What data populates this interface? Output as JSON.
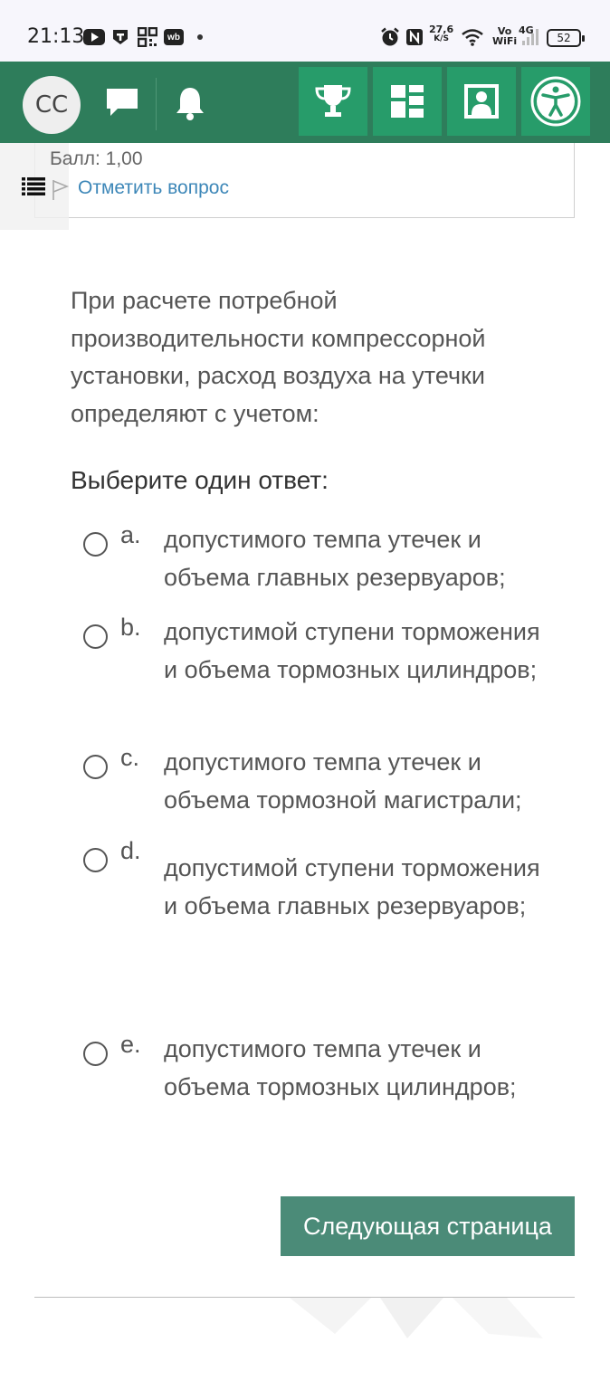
{
  "status_bar": {
    "time": "21:13",
    "net_speed_value": "27,6",
    "net_speed_unit": "K/S",
    "volte_top": "Vo",
    "volte_bottom": "WiFi",
    "network": "4G",
    "battery": "52",
    "icons": [
      "youtube-icon",
      "tasks-icon",
      "qr-icon",
      "wb-icon",
      "dot-icon",
      "alarm-icon",
      "nfc-icon",
      "wifi-icon",
      "signal-icon",
      "battery-icon"
    ],
    "wb_label": "wb"
  },
  "header": {
    "avatar_initials": "CC",
    "icons": [
      "message-icon",
      "bell-icon"
    ],
    "buttons": [
      {
        "name": "trophy-button",
        "icon": "trophy-icon"
      },
      {
        "name": "dashboard-button",
        "icon": "dashboard-icon"
      },
      {
        "name": "profile-button",
        "icon": "profile-icon"
      },
      {
        "name": "accessibility-button",
        "icon": "accessibility-icon"
      }
    ],
    "colors": {
      "bar": "#2e7d5b",
      "button": "#279c6a"
    }
  },
  "question_info": {
    "score": "Балл: 1,00",
    "flag_label": "Отметить вопрос"
  },
  "question": {
    "text": "При расчете потребной производительности компрессорной установки, расход воздуха на утечки определяют с учетом:",
    "prompt": "Выберите один ответ:",
    "options": [
      {
        "letter": "a.",
        "text": "допустимого темпа утечек и объема главных резервуаров;",
        "selected": false
      },
      {
        "letter": "b.",
        "text": "допустимой ступени торможения и объема тормозных цилиндров;",
        "selected": false
      },
      {
        "letter": "c.",
        "text": "допустимого темпа утечек и объема тормозной магистрали;",
        "selected": false
      },
      {
        "letter": "d.",
        "text": "допустимой ступени торможения и объема главных резервуаров;",
        "selected": false
      },
      {
        "letter": "e.",
        "text": "допустимого темпа утечек и объема тормозных цилиндров;",
        "selected": false
      }
    ]
  },
  "navigation": {
    "next_label": "Следующая страница",
    "next_color": "#4b8b78"
  }
}
